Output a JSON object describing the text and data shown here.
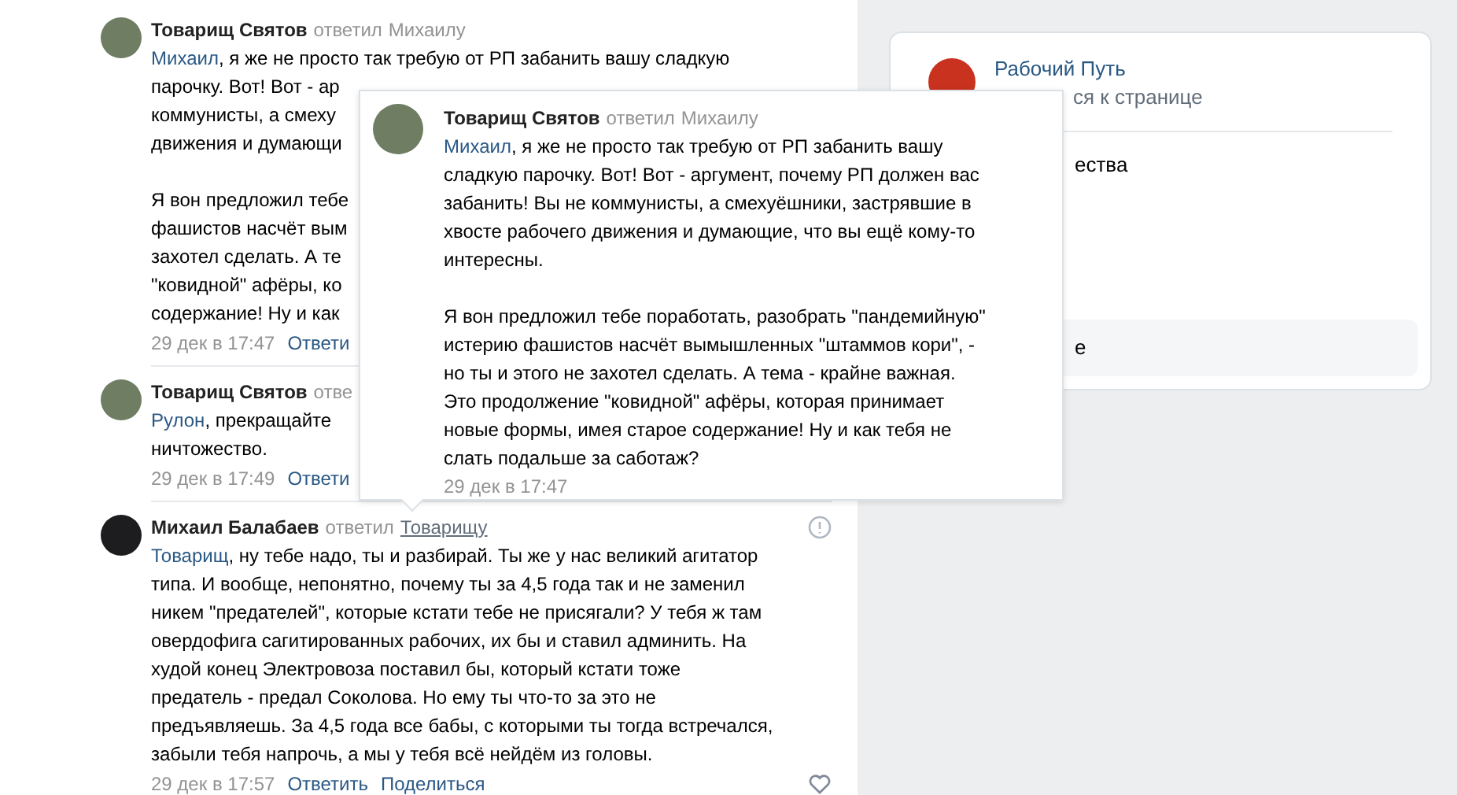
{
  "comments": [
    {
      "author": "Товарищ Святов",
      "reply_prefix": "ответил",
      "reply_to": "Михаилу",
      "reply_to_hovered": false,
      "mention": "Михаил",
      "paragraphs": [
        [
          ", я же не просто так требую от РП забанить вашу сладкую",
          "парочку. Вот! Вот - ар",
          "коммунисты, а смеху",
          "движения и думающи"
        ],
        [
          "Я вон предложил тебе",
          "фашистов насчёт вым",
          "захотел сделать. А те",
          "\"ковидной\" афёры, ко",
          "содержание! Ну и как"
        ]
      ],
      "date": "29 дек в 17:47",
      "actions": [
        "Ответи"
      ]
    },
    {
      "author": "Товарищ Святов",
      "reply_prefix": "отве",
      "mention": "Рулон",
      "paragraphs": [
        [
          ", прекращайте",
          "ничтожество."
        ]
      ],
      "date": "29 дек в 17:49",
      "actions": [
        "Ответи"
      ]
    },
    {
      "author": "Михаил Балабаев",
      "reply_prefix": "ответил",
      "reply_to": "Товарищу",
      "reply_to_hovered": true,
      "hovered": true,
      "mention": "Товарищ",
      "paragraphs": [
        [
          ", ну тебе надо, ты и разбирай. Ты же у нас великий агитатор",
          "типа. И вообще, непонятно, почему ты за 4,5 года так и не заменил",
          "никем \"предателей\", которые кстати тебе не присягали? У тебя ж там",
          "овердофига сагитированных рабочих, их бы и ставил админить. На",
          "худой конец Электровоза поставил бы, который кстати тоже",
          "предатель - предал Соколова. Но ему ты что-то за это не",
          "предъявляешь. За 4,5 года все бабы, с которыми ты тогда встречался,",
          "забыли тебя напрочь, а мы у тебя всё нейдём из головы."
        ]
      ],
      "date": "29 дек в 17:57",
      "actions": [
        "Ответить",
        "Поделиться"
      ]
    }
  ],
  "popup": {
    "author": "Товарищ Святов",
    "reply_prefix": "ответил",
    "reply_to": "Михаилу",
    "mention": "Михаил",
    "paragraphs": [
      [
        ", я же не просто так требую от РП забанить вашу",
        "сладкую парочку. Вот! Вот - аргумент, почему РП должен вас",
        "забанить! Вы не коммунисты, а смехуёшники, застрявшие в",
        "хвосте рабочего движения и думающие, что вы ещё кому-то",
        "интересны."
      ],
      [
        "Я вон предложил тебе поработать, разобрать \"пандемийную\"",
        "истерию фашистов насчёт вымышленных \"штаммов кори\", -",
        "но ты и этого не захотел сделать. А тема - крайне важная.",
        "Это продолжение \"ковидной\" афёры, которая принимает",
        "новые формы, имея старое содержание! Ну и как тебя не",
        "слать подальше за саботаж?"
      ]
    ],
    "date": "29 дек в 17:47"
  },
  "group_card": {
    "name": "Рабочий Путь",
    "subtitle": "ся к странице",
    "menu_item": "ества",
    "bottom_item": "е"
  }
}
